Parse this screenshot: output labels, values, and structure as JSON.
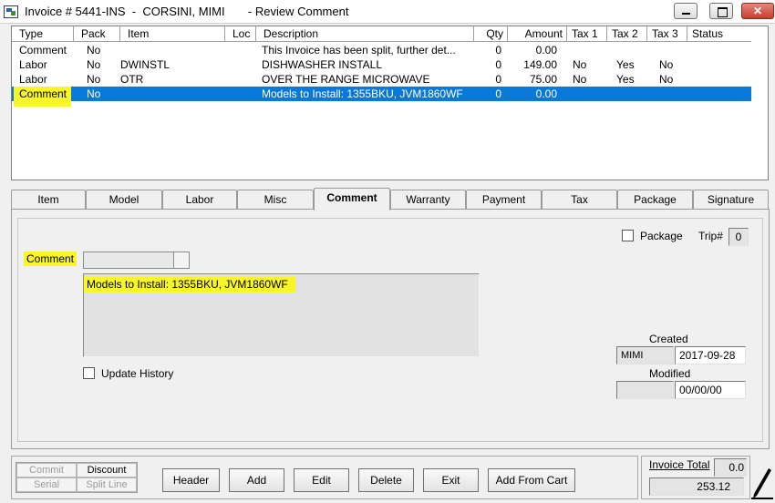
{
  "window": {
    "title": "Invoice # 5441-INS  -  CORSINI, MIMI       - Review Comment"
  },
  "grid": {
    "columns": [
      "Type",
      "Pack",
      "Item",
      "Loc",
      "Description",
      "Qty",
      "Amount",
      "Tax 1",
      "Tax 2",
      "Tax 3",
      "Status"
    ],
    "rows": [
      {
        "type": "Comment",
        "pack": "No",
        "item": "",
        "loc": "",
        "description": "This Invoice has been split, further det...",
        "qty": "0",
        "amount": "0.00",
        "tax1": "",
        "tax2": "",
        "tax3": "",
        "status": ""
      },
      {
        "type": "Labor",
        "pack": "No",
        "item": "DWINSTL",
        "loc": "",
        "description": "DISHWASHER INSTALL",
        "qty": "0",
        "amount": "149.00",
        "tax1": "No",
        "tax2": "Yes",
        "tax3": "No",
        "status": ""
      },
      {
        "type": "Labor",
        "pack": "No",
        "item": "OTR",
        "loc": "",
        "description": "OVER THE RANGE MICROWAVE",
        "qty": "0",
        "amount": "75.00",
        "tax1": "No",
        "tax2": "Yes",
        "tax3": "No",
        "status": ""
      },
      {
        "type": "Comment",
        "pack": "No",
        "item": "",
        "loc": "",
        "description": "Models to Install: 1355BKU, JVM1860WF",
        "qty": "0",
        "amount": "0.00",
        "tax1": "",
        "tax2": "",
        "tax3": "",
        "status": "",
        "selected": true
      }
    ]
  },
  "tabs": [
    {
      "label": "Item"
    },
    {
      "label": "Model"
    },
    {
      "label": "Labor"
    },
    {
      "label": "Misc"
    },
    {
      "label": "Comment",
      "active": true
    },
    {
      "label": "Warranty"
    },
    {
      "label": "Payment"
    },
    {
      "label": "Tax"
    },
    {
      "label": "Package"
    },
    {
      "label": "Signature"
    }
  ],
  "comment_tab": {
    "package_label": "Package",
    "trip_label": "Trip#",
    "trip_value": "0",
    "comment_label": "Comment",
    "comment_text": "Models to Install: 1355BKU, JVM1860WF",
    "update_history_label": "Update History",
    "created_label": "Created",
    "created_user": "MIMI",
    "created_date": "2017-09-28",
    "modified_label": "Modified",
    "modified_user": "",
    "modified_date": "00/00/00"
  },
  "toolbar": {
    "commit": "Commit",
    "discount": "Discount",
    "serial": "Serial",
    "split_line": "Split Line",
    "header": "Header",
    "add": "Add",
    "edit": "Edit",
    "delete": "Delete",
    "exit": "Exit",
    "add_from_cart": "Add From Cart"
  },
  "totals": {
    "invoice_total_label": "Invoice Total",
    "small_value": "0.0",
    "invoice_total": "253.12"
  },
  "colors": {
    "selection": "#0a78d7",
    "highlight": "#f8f528"
  },
  "icons": [
    "app-icon",
    "minimize-icon",
    "maximize-icon",
    "close-icon",
    "signature-pen-icon"
  ]
}
